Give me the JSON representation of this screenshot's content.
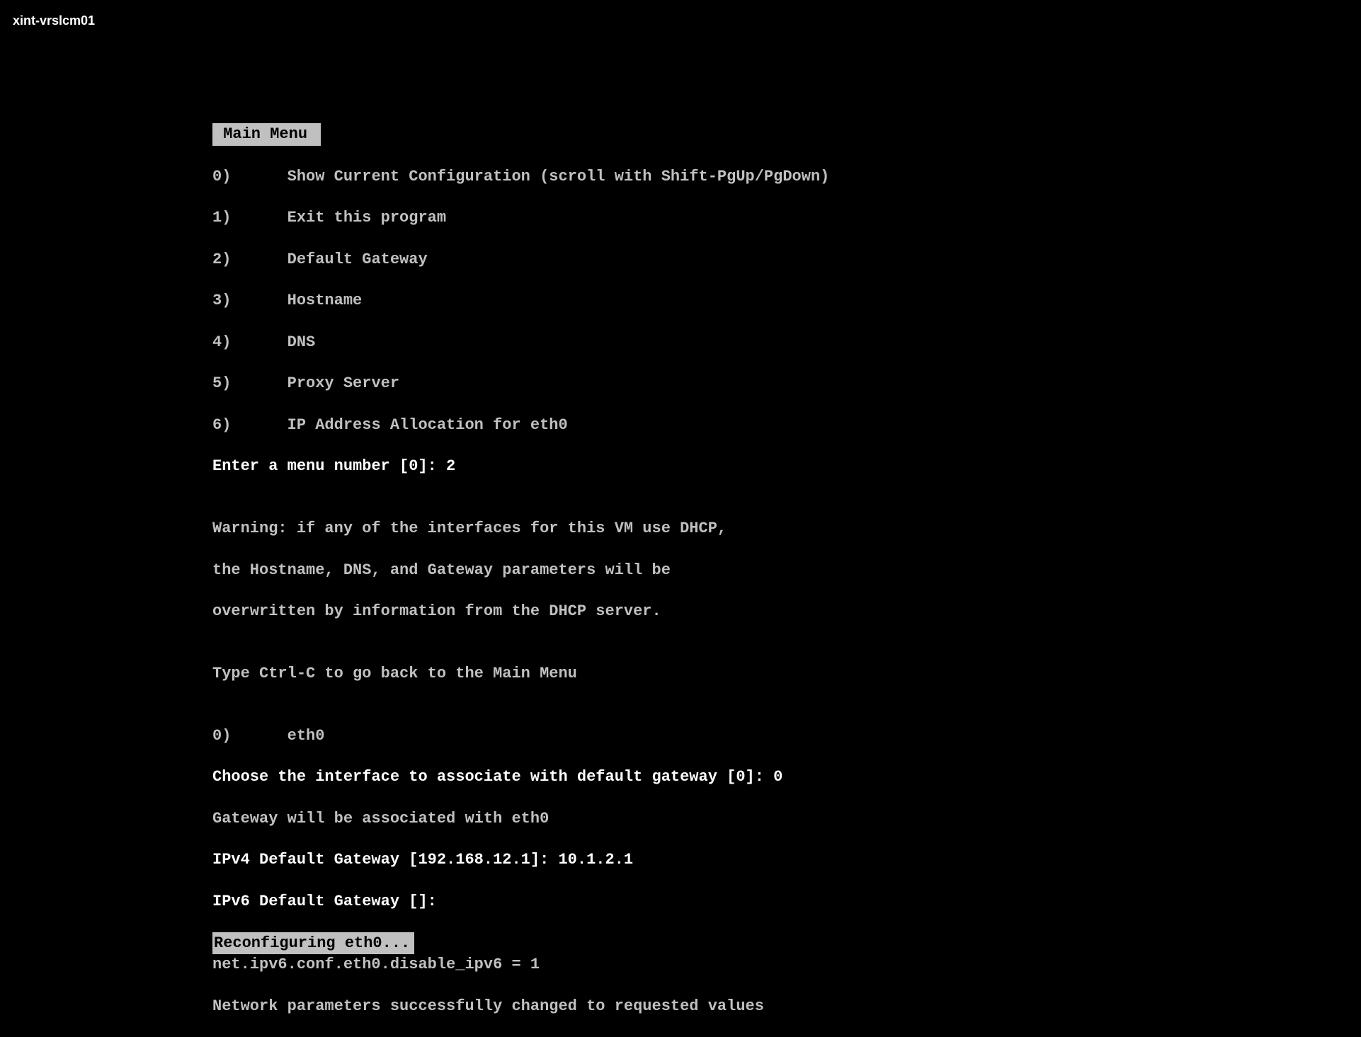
{
  "vm_name": "xint-vrslcm01",
  "menu_title": " Main Menu ",
  "menu": {
    "items": [
      {
        "num": "0)",
        "label": "Show Current Configuration (scroll with Shift-PgUp/PgDown)"
      },
      {
        "num": "1)",
        "label": "Exit this program"
      },
      {
        "num": "2)",
        "label": "Default Gateway"
      },
      {
        "num": "3)",
        "label": "Hostname"
      },
      {
        "num": "4)",
        "label": "DNS"
      },
      {
        "num": "5)",
        "label": "Proxy Server"
      },
      {
        "num": "6)",
        "label": "IP Address Allocation for eth0"
      }
    ],
    "prompt": "Enter a menu number [0]: 2"
  },
  "warning": {
    "line1": "Warning: if any of the interfaces for this VM use DHCP,",
    "line2": "the Hostname, DNS, and Gateway parameters will be",
    "line3": "overwritten by information from the DHCP server."
  },
  "back_hint": "Type Ctrl-C to go back to the Main Menu",
  "iface_list": {
    "num": "0)",
    "label": "eth0"
  },
  "iface_prompt": "Choose the interface to associate with default gateway [0]: 0",
  "iface_assoc": "Gateway will be associated with eth0",
  "gw4_prompt": "IPv4 Default Gateway [192.168.12.1]: 10.1.2.1",
  "gw6_prompt": "IPv6 Default Gateway []:",
  "reconfig": "Reconfiguring eth0...",
  "sysctl": "net.ipv6.conf.eth0.disable_ipv6 = 1",
  "result": "Network parameters successfully changed to requested values"
}
